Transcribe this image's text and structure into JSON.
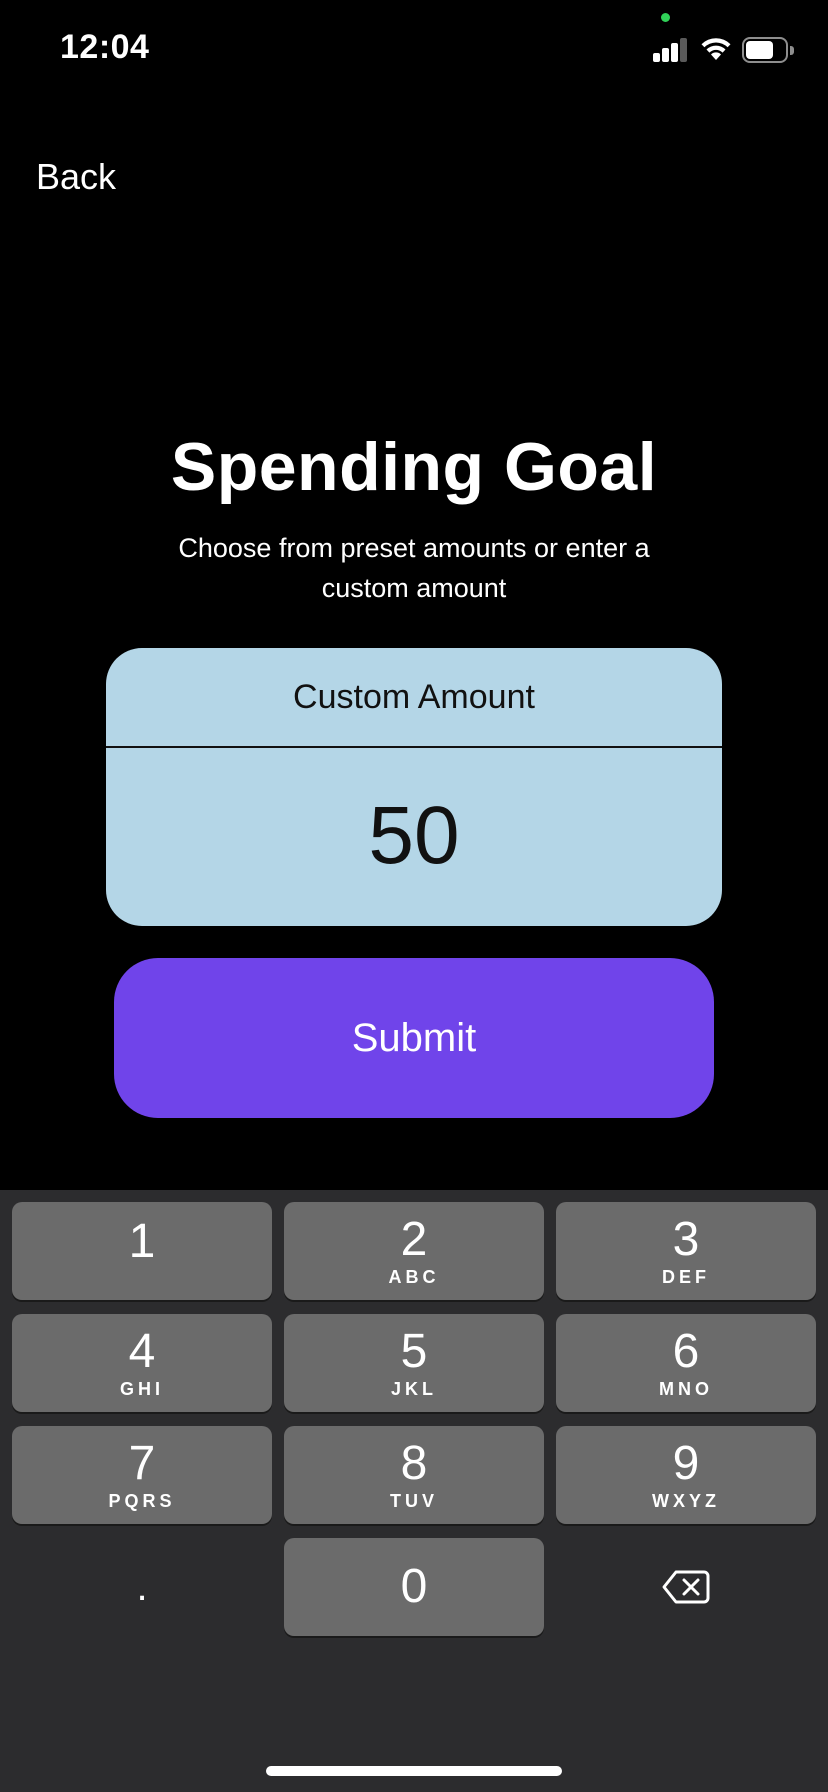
{
  "status_bar": {
    "time": "12:04",
    "icons": [
      "privacy-dot",
      "cellular-signal-icon",
      "wifi-icon",
      "battery-icon"
    ],
    "battery_level": 0.7,
    "privacy_dot_color": "#30d158"
  },
  "nav": {
    "back_label": "Back"
  },
  "header": {
    "title": "Spending Goal",
    "subtitle": "Choose from preset amounts or enter a custom amount"
  },
  "amount_card": {
    "label": "Custom Amount",
    "value": "50",
    "background": "#b4d6e7"
  },
  "submit": {
    "label": "Submit",
    "color": "#7044ea"
  },
  "keypad": {
    "keys": [
      {
        "digit": "1",
        "letters": ""
      },
      {
        "digit": "2",
        "letters": "ABC"
      },
      {
        "digit": "3",
        "letters": "DEF"
      },
      {
        "digit": "4",
        "letters": "GHI"
      },
      {
        "digit": "5",
        "letters": "JKL"
      },
      {
        "digit": "6",
        "letters": "MNO"
      },
      {
        "digit": "7",
        "letters": "PQRS"
      },
      {
        "digit": "8",
        "letters": "TUV"
      },
      {
        "digit": "9",
        "letters": "WXYZ"
      },
      {
        "digit": ".",
        "letters": ""
      },
      {
        "digit": "0",
        "letters": ""
      },
      {
        "digit": "",
        "letters": "",
        "icon": "delete-backspace-icon"
      }
    ],
    "background": "#2c2c2e",
    "key_color": "#6b6b6b"
  }
}
